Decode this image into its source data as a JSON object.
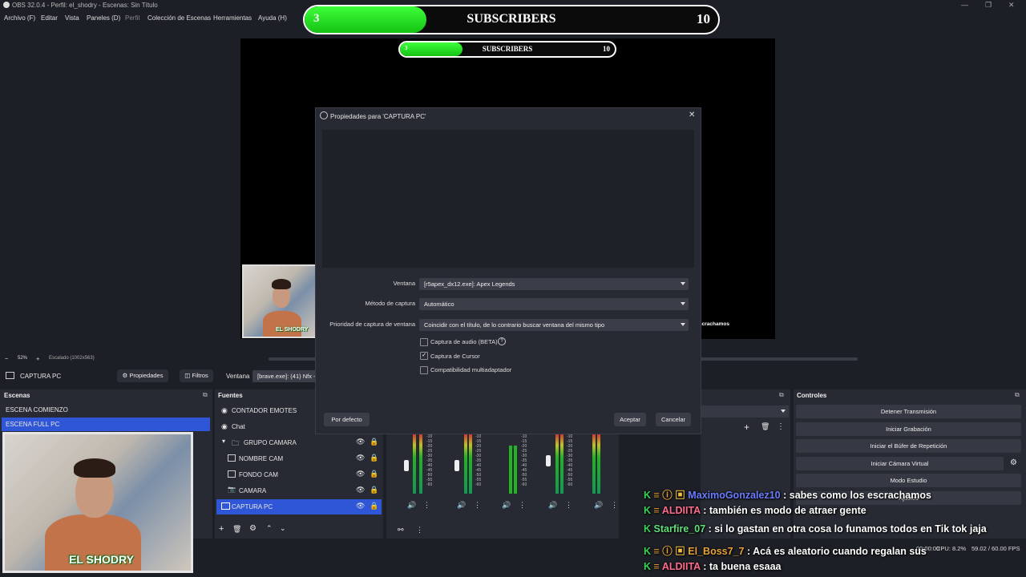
{
  "window": {
    "title": "OBS 32.0.4 - Perfil: el_shodry - Escenas: Sin Título"
  },
  "menu": [
    "Archivo (F)",
    "Editar",
    "Vista",
    "Paneles (D)",
    "Perfil",
    "Colección de Escenas",
    "Herramientas",
    "Ayuda (H)"
  ],
  "subscribers_big": {
    "current": "3",
    "label": "SUBSCRIBERS",
    "goal": "10",
    "progress": 0.3
  },
  "subscribers_small": {
    "current": "3",
    "label": "SUBSCRIBERS",
    "goal": "10",
    "progress": 0.3
  },
  "preview": {
    "overlay_text": "scrachamos"
  },
  "zoom": {
    "minus": "−",
    "percent": "52%",
    "plus": "+",
    "scale": "Escalado (1002x563)"
  },
  "source_bar": {
    "name": "CAPTURA PC",
    "properties": "Propiedades",
    "filters": "Filtros",
    "window_label": "Ventana",
    "window_value": "[brave.exe]: (41) Nfx -"
  },
  "dialog": {
    "title": "Propiedades para 'CAPTURA PC'",
    "fields": [
      {
        "label": "Ventana",
        "value": "[r5apex_dx12.exe]: Apex Legends"
      },
      {
        "label": "Método de captura",
        "value": "Automático"
      },
      {
        "label": "Prioridad de captura de ventana",
        "value": "Coincidir con el título, de lo contrario buscar ventana del mismo tipo"
      }
    ],
    "checkboxes": [
      {
        "label": "Captura de audio (BETA)",
        "checked": false
      },
      {
        "label": "Captura de Cursor",
        "checked": true
      },
      {
        "label": "Compatibilidad multiadaptador",
        "checked": false
      }
    ],
    "defaults_button": "Por defecto",
    "ok_button": "Aceptar",
    "cancel_button": "Cancelar"
  },
  "scenes": {
    "header": "Escenas",
    "items": [
      "ESCENA COMIENZO",
      "ESCENA FULL PC"
    ],
    "selected": 1
  },
  "sources": {
    "header": "Fuentes",
    "items": [
      {
        "label": "CONTADOR EMOTES",
        "indent": false
      },
      {
        "label": "Chat",
        "indent": false
      },
      {
        "label": "GRUPO CAMARA",
        "indent": false
      },
      {
        "label": "NOMBRE CAM",
        "indent": true
      },
      {
        "label": "FONDO CAM",
        "indent": true
      },
      {
        "label": "CAMARA",
        "indent": true
      },
      {
        "label": "CAPTURA PC",
        "indent": false
      }
    ]
  },
  "meter_scale": [
    "-10",
    "-15",
    "-20",
    "-25",
    "-30",
    "-35",
    "-40",
    "-45",
    "-50",
    "-55",
    "-60"
  ],
  "controls": {
    "header": "Controles",
    "buttons": [
      "Detener Transmisión",
      "Iniciar Grabación",
      "Iniciar el Búfer de Repetición",
      "Iniciar Cámara Virtual",
      "Modo Estudio",
      "Ajustes"
    ]
  },
  "cam_label": "EL SHODRY",
  "status": {
    "time": "00:00:00",
    "cpu": "CPU: 8.2%",
    "fps": "59.02 / 60.00 FPS"
  },
  "chat": [
    {
      "user": "MaximoGonzalez10",
      "message": ": sabes como los escrachamos",
      "color": "#6a7cff"
    },
    {
      "user": "ALDIITA",
      "message": ": también es modo de atraer gente",
      "color": "#ff6b8b"
    },
    {
      "user": "Starfire_07",
      "message": ": si lo gastan en otra cosa lo funamos todos en Tik tok jaja",
      "color": "#5fe07a"
    },
    {
      "user": "El_Boss7_7",
      "message": ": Acá es aleatorio cuando regalan sus",
      "color": "#e8a33a"
    },
    {
      "user": "ALDIITA",
      "message": ": ta buena esaaa",
      "color": "#ff6b8b"
    }
  ]
}
